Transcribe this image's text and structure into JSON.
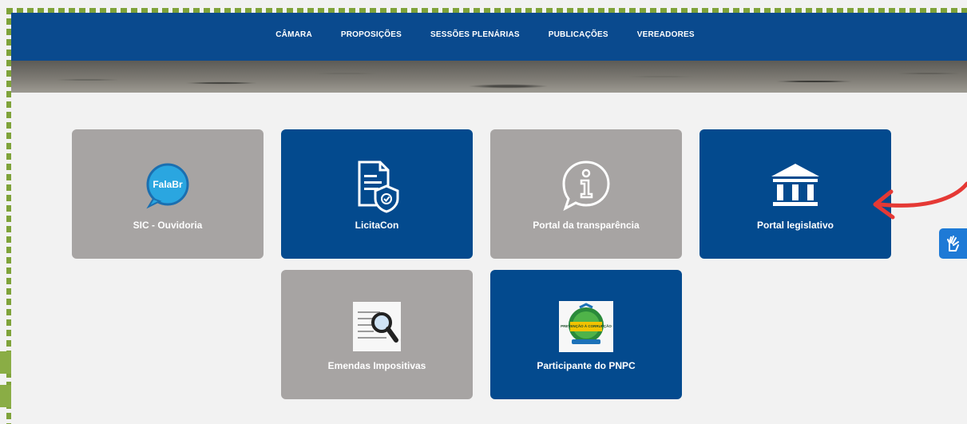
{
  "nav": {
    "items": [
      "CÂMARA",
      "PROPOSIÇÕES",
      "SESSÕES PLENÁRIAS",
      "PUBLICAÇÕES",
      "VEREADORES"
    ]
  },
  "tiles": [
    {
      "label": "SIC - Ouvidoria",
      "icon": "falabr-logo-icon",
      "logo_text": "FalaBr",
      "color": "#a7a4a3"
    },
    {
      "label": "LicitaCon",
      "icon": "document-shield-icon",
      "color": "#034a8e"
    },
    {
      "label": "Portal da transparência",
      "icon": "info-speech-bubble-icon",
      "color": "#a7a4a3"
    },
    {
      "label": "Portal legislativo",
      "icon": "government-building-icon",
      "color": "#034a8e"
    },
    {
      "label": "Emendas Impositivas",
      "icon": "document-magnifier-icon",
      "color": "#a7a4a3"
    },
    {
      "label": "Participante do PNPC",
      "icon": "pnpc-badge-icon",
      "logo_text": "PREVENÇÃO À CORRUPÇÃO",
      "color": "#034a8e"
    }
  ],
  "annotation": {
    "arrow_color": "#e53935",
    "arrow_icon": "curved-arrow-icon",
    "border_color": "#7fa33a"
  },
  "accessibility": {
    "icon": "hand-sign-language-icon",
    "color": "#1e7ad6"
  }
}
